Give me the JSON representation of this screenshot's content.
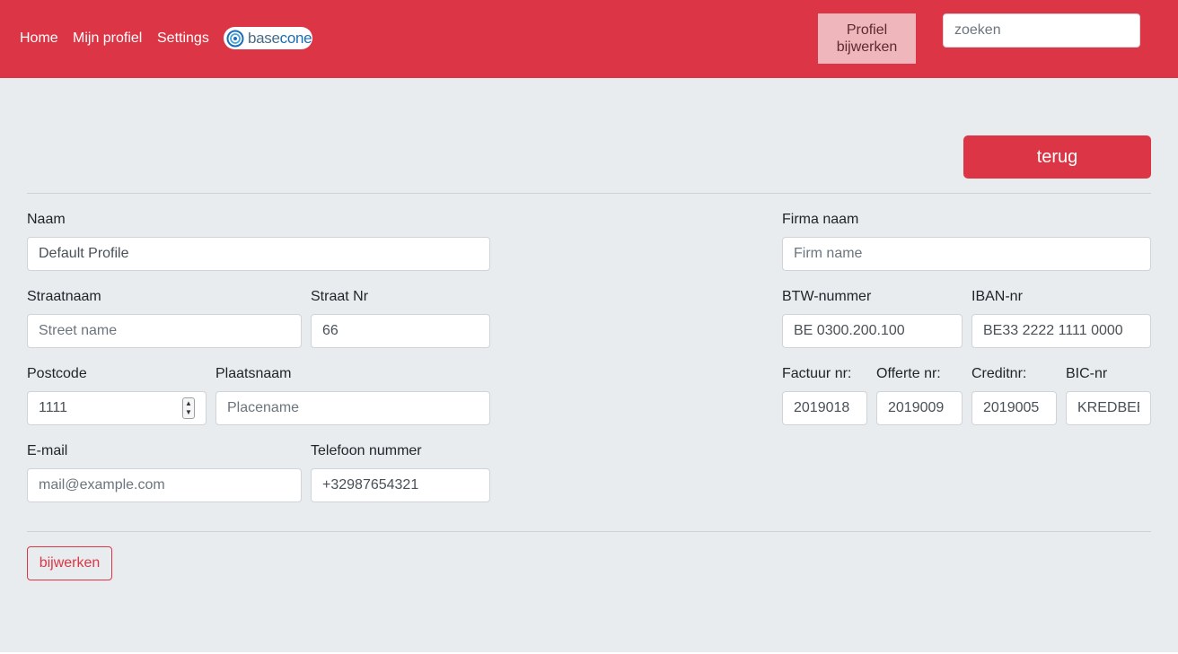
{
  "nav": {
    "home": "Home",
    "profile": "Mijn profiel",
    "settings": "Settings",
    "brand_part1": "base",
    "brand_part2": "cone",
    "profile_update_button": "Profiel bijwerken",
    "search_placeholder": "zoeken"
  },
  "colors": {
    "primary": "#dc3545",
    "background": "#e9ecef",
    "brand_blue": "#1a6fb3"
  },
  "actions": {
    "back": "terug",
    "update": "bijwerken"
  },
  "form": {
    "name": {
      "label": "Naam",
      "value": "Default Profile"
    },
    "street": {
      "label": "Straatnaam",
      "placeholder": "Street name"
    },
    "street_nr": {
      "label": "Straat Nr",
      "value": "66"
    },
    "postcode": {
      "label": "Postcode",
      "value": "1111"
    },
    "place": {
      "label": "Plaatsnaam",
      "placeholder": "Placename"
    },
    "email": {
      "label": "E-mail",
      "placeholder": "mail@example.com"
    },
    "phone": {
      "label": "Telefoon nummer",
      "value": "+32987654321"
    },
    "firm": {
      "label": "Firma naam",
      "placeholder": "Firm name"
    },
    "vat": {
      "label": "BTW-nummer",
      "value": "BE 0300.200.100"
    },
    "iban": {
      "label": "IBAN-nr",
      "value": "BE33 2222 1111 0000"
    },
    "invoice_nr": {
      "label": "Factuur nr:",
      "value": "2019018"
    },
    "quote_nr": {
      "label": "Offerte nr:",
      "value": "2019009"
    },
    "credit_nr": {
      "label": "Creditnr:",
      "value": "2019005"
    },
    "bic": {
      "label": "BIC-nr",
      "value": "KREDBEBB"
    }
  }
}
